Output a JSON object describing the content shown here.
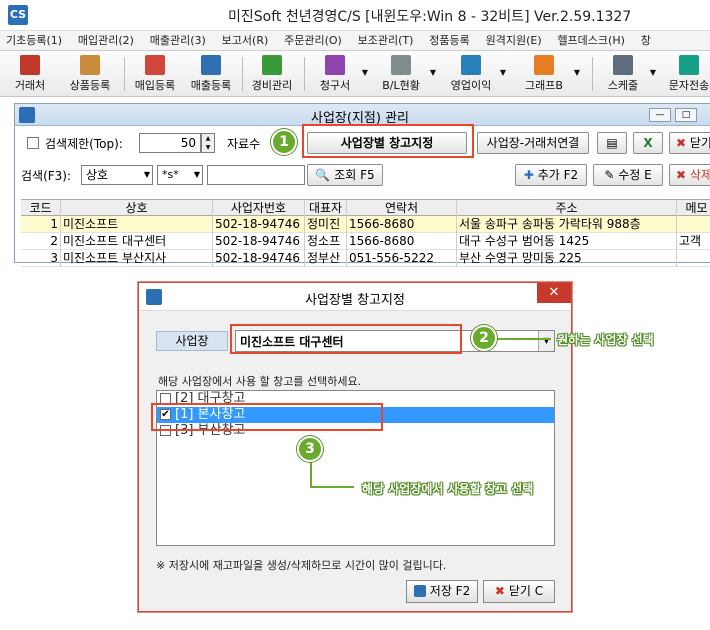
{
  "app": {
    "title": "미진Soft 천년경영C/S [내윈도우:Win 8 - 32비트] Ver.2.59.1327",
    "logo_text": "CS"
  },
  "menu": [
    "기초등록(1)",
    "매입관리(2)",
    "매출관리(3)",
    "보고서(R)",
    "주문관리(O)",
    "보조관리(T)",
    "정품등록",
    "원격지원(E)",
    "헬프데스크(H)",
    "창"
  ],
  "toolbar": {
    "items": [
      "거래처",
      "상품등록",
      "매입등록",
      "매출등록",
      "경비관리",
      "청구서",
      "B/L현황",
      "영업이익",
      "그래프B",
      "스케줄",
      "문자전송"
    ]
  },
  "child_window": {
    "title": "사업장(지점) 관리",
    "search_limit_label": "검색제한(Top):",
    "search_limit_value": "50",
    "count_label": "자료수",
    "btn_warehouse": "사업장별 창고지정",
    "btn_link": "사업장-거래처연결",
    "btn_close": "닫기",
    "search_label": "검색(F3):",
    "search_field": "상호",
    "search_op": "*s*",
    "btn_search": "조회 F5",
    "btn_add": "추가 F2",
    "btn_edit": "수정 E",
    "btn_delete": "삭제"
  },
  "grid": {
    "headers": [
      "코드",
      "상호",
      "사업자번호",
      "대표자",
      "연락처",
      "주소",
      "메모"
    ],
    "rows": [
      [
        "1",
        "미진소프트",
        "502-18-94746",
        "정미진",
        "1566-8680",
        "서울 송파구 송파동 가락타워 988층",
        ""
      ],
      [
        "2",
        "미진소프트 대구센터",
        "502-18-94746",
        "정소프",
        "1566-8680",
        "대구 수성구 범어동 1425",
        "고객"
      ],
      [
        "3",
        "미진소프트 부산지사",
        "502-18-94746",
        "정부산",
        "051-556-5222",
        "부산 수영구 망미동 225",
        ""
      ]
    ]
  },
  "dialog": {
    "title": "사업장별 창고지정",
    "close_symbol": "✕",
    "biz_label": "사업장",
    "biz_value": "미진소프트 대구센터",
    "instruction": "해당 사업장에서 사용 할 창고를 선택하세요.",
    "warehouses": [
      {
        "label": "[2] 대구창고",
        "checked": false
      },
      {
        "label": "[1] 본사창고",
        "checked": true
      },
      {
        "label": "[3] 부산창고",
        "checked": false
      }
    ],
    "note": "※ 저장시에 재고파일을 생성/삭제하므로 시간이 많이 걸립니다.",
    "btn_save": "저장 F2",
    "btn_close": "닫기 C"
  },
  "callouts": {
    "c1": "1",
    "c2": "2",
    "c2_text": "원하는 사업장 선택",
    "c3": "3",
    "c3_text": "해당 사업장에서 사용할 창고 선택"
  },
  "colors": {
    "accent_red": "#e8472b",
    "callout_green": "#6aaa2e",
    "selection_blue": "#3399ff"
  }
}
